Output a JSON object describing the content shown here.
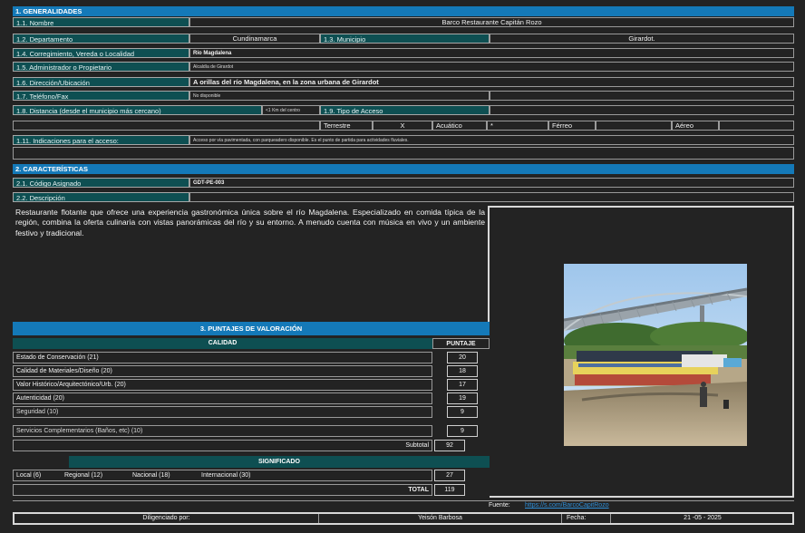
{
  "sec1": "1. GENERALIDADES",
  "f1": {
    "label": "1.1. Nombre",
    "value": "Barco Restaurante Capitán Rozo"
  },
  "f2": {
    "label": "1.2. Departamento",
    "value": "Cundinamarca",
    "label2": "1.3. Municipio",
    "value2": "Girardot."
  },
  "f4": {
    "label": "1.4. Corregimiento, Vereda o Localidad",
    "value": "Río Magdalena"
  },
  "f5": {
    "label": "1.5. Administrador o Propietario",
    "value": "Alcaldía de Girardot"
  },
  "f6": {
    "label": "1.6. Dirección/Ubicación",
    "value": "A orillas del río Magdalena, en la zona urbana de Girardot"
  },
  "f7": {
    "label": "1.7. Teléfono/Fax",
    "value": "No disponible"
  },
  "f8": {
    "label": "1.8. Distancia (desde el municipio más cercano)",
    "value": "<1 Km del centro",
    "label2": "1.9. Tipo de Acceso"
  },
  "access": {
    "terrestre": "Terrestre",
    "x": "X",
    "acuatico": "Acuático",
    "dash": "*",
    "ferreo": "Férreo",
    "aereo": "Aéreo"
  },
  "f11": {
    "label": "1.11. Indicaciones para el acceso:",
    "value": "Acceso por vía pavimentada, con parqueadero disponible. Es el punto de partida para actividades fluviales."
  },
  "sec2": "2. CARACTERÍSTICAS",
  "c1": {
    "label": "2.1. Código Asignado",
    "value": "GDT-PE-003"
  },
  "c2": {
    "label": "2.2. Descripción"
  },
  "description": "Restaurante flotante que ofrece una experiencia gastronómica única sobre el río Magdalena. Especializado en comida típica de la región, combina la oferta culinaria con vistas panorámicas del río y su entorno. A menudo cuenta con música en vivo y un ambiente festivo y tradicional.",
  "sec3": "3. PUNTAJES DE VALORACIÓN",
  "calidad": "CALIDAD",
  "puntaje": "PUNTAJE",
  "scores": [
    {
      "name": "Estado de Conservación (21)",
      "value": "20"
    },
    {
      "name": "Calidad de Materiales/Diseño (20)",
      "value": "18"
    },
    {
      "name": "Valor Histórico/Arquitectónico/Urb. (20)",
      "value": "17"
    },
    {
      "name": "Autenticidad (20)",
      "value": "19"
    },
    {
      "name": "Seguridad (10)",
      "value": "9"
    },
    {
      "name": "Servicios Complementarios (Baños, etc) (10)",
      "value": "9"
    }
  ],
  "subtotal": {
    "label": "Subtotal",
    "value": "92"
  },
  "significado": "SIGNIFICADO",
  "sig": {
    "local": "Local (6)",
    "regional": "Regional (12)",
    "nacional": "Nacional (18)",
    "internacional": "Internacional (30)",
    "value": "27"
  },
  "total": {
    "label": "TOTAL",
    "value": "119"
  },
  "fuente": {
    "label": "Fuente:",
    "link": "https://s.com/BarcoCapitRozo"
  },
  "footer": {
    "dilig_label": "Diligenciado por:",
    "dilig_value": "Yeisón Barbosa",
    "fecha_label": "Fecha:",
    "fecha_value": "21 -05 - 2025"
  },
  "colors": {
    "section": "#1479b8",
    "label": "#0e4f52",
    "background": "#232323",
    "link": "#2f8fd8"
  }
}
